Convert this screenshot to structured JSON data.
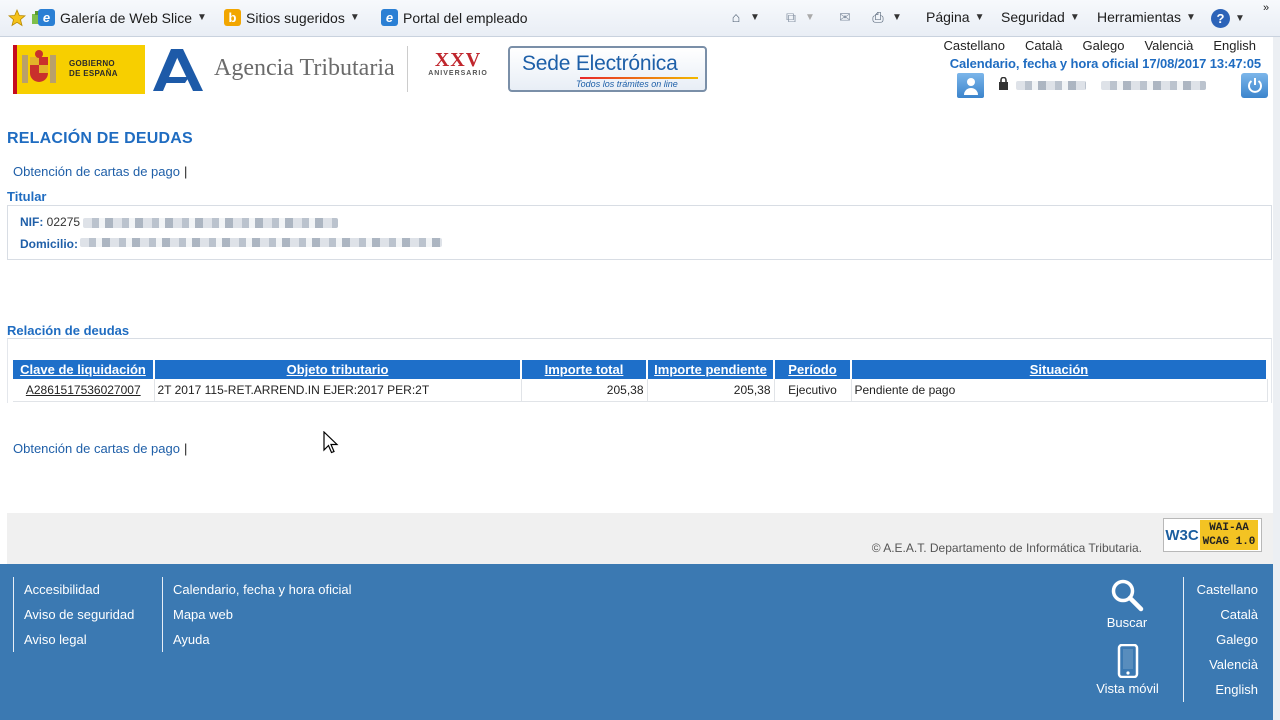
{
  "browser": {
    "favorites": [
      {
        "label": "Galería de Web Slice",
        "icon": "ie-icon"
      },
      {
        "label": "Sitios sugeridos",
        "icon": "bing-icon"
      },
      {
        "label": "Portal del empleado",
        "icon": "ie-icon"
      }
    ],
    "tools": {
      "pagina": "Página",
      "seguridad": "Seguridad",
      "herramientas": "Herramientas"
    }
  },
  "header": {
    "gobierno_text": "GOBIERNO\nDE ESPAÑA",
    "agency_name": "Agencia Tributaria",
    "anniversary_big": "XXV",
    "anniversary_small": "ANIVERSARIO",
    "sede_title": "Sede Electrónica",
    "sede_subtitle": "Todos los trámites on line",
    "languages": [
      "Castellano",
      "Català",
      "Galego",
      "Valencià",
      "English"
    ],
    "datetime": "Calendario, fecha y hora oficial 17/08/2017 13:47:05"
  },
  "main": {
    "page_title": "RELACIÓN DE DEUDAS",
    "cartas_link": "Obtención de cartas de pago",
    "pipe": "|",
    "titular_label": "Titular",
    "nif_label": "NIF:",
    "nif_value": "02275",
    "domicilio_label": "Domicilio:",
    "deudas_label": "Relación de deudas",
    "table": {
      "headers": [
        "Clave de liquidación",
        "Objeto tributario",
        "Importe total",
        "Importe pendiente",
        "Período",
        "Situación"
      ],
      "rows": [
        [
          "A2861517536027007",
          "2T 2017 115-RET.ARREND.IN EJER:2017 PER:2T",
          "205,38",
          "205,38",
          "Ejecutivo",
          "Pendiente de pago"
        ]
      ]
    }
  },
  "footer": {
    "copyright": "© A.E.A.T. Departamento de Informática Tributaria.",
    "w3c": "W3C",
    "wcag_line1": "WAI-AA",
    "wcag_line2": "WCAG 1.0",
    "col1": [
      "Accesibilidad",
      "Aviso de seguridad",
      "Aviso legal"
    ],
    "col2": [
      "Calendario, fecha y hora oficial",
      "Mapa web",
      "Ayuda"
    ],
    "search_label": "Buscar",
    "mobile_label": "Vista móvil",
    "languages": [
      "Castellano",
      "Català",
      "Galego",
      "Valencià",
      "English"
    ]
  },
  "colors": {
    "brand_blue": "#1f6cc1",
    "table_header": "#1e6fc9",
    "footer_bg": "#3b79b2",
    "link_brown": "#a0522d"
  }
}
